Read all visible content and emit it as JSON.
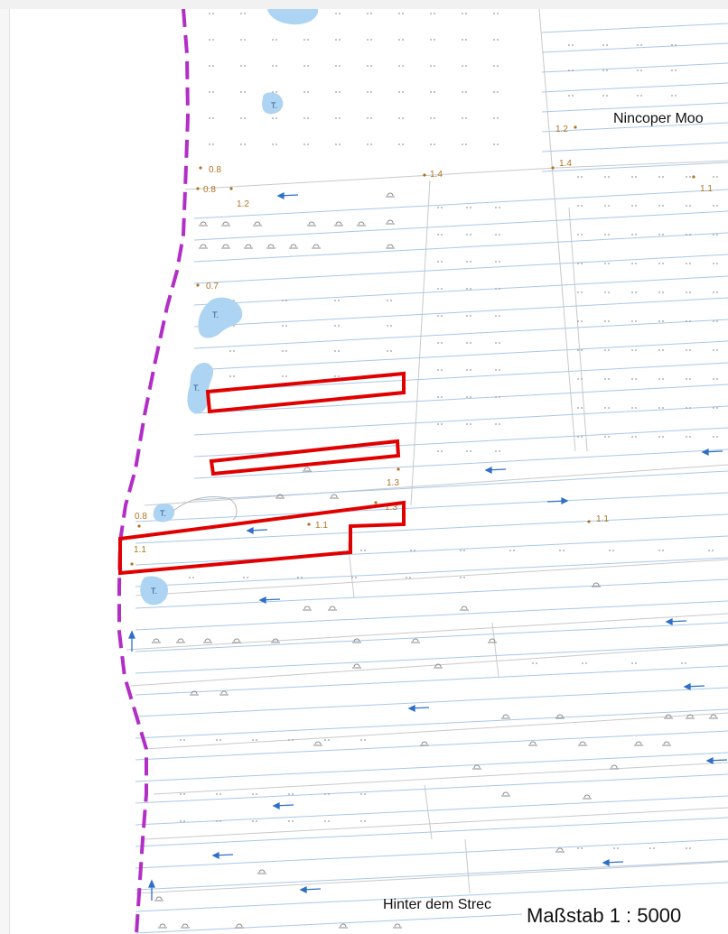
{
  "labels": {
    "nincoper": "Nincoper Moo",
    "hinter": "Hinter dem Strec",
    "scale": "Maßstab 1 : 5000",
    "pond": "T."
  },
  "heights": [
    "0.8",
    "0.8",
    "1.2",
    "1.4",
    "1.2",
    "1.4",
    "1.1",
    "0.7",
    "1.3",
    "0.8",
    "1.1",
    "1.3",
    "1.1",
    "1.1"
  ],
  "colors": {
    "boundary": "#b22ec7",
    "highlight": "#e00000",
    "water": "#add4f2",
    "ditch": "#a8c8e8",
    "parcel": "#c9c9c9",
    "heights": "#b0741f",
    "arrows": "#2f6fc9"
  }
}
